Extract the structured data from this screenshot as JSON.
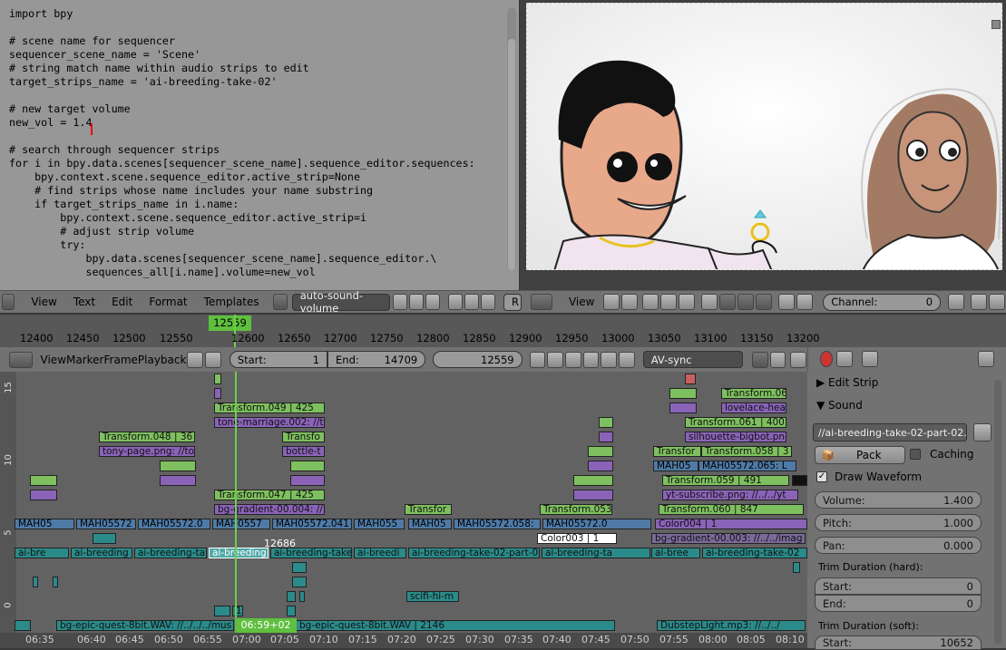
{
  "editor": {
    "code": "import bpy\n\n# scene name for sequencer\nsequencer_scene_name = 'Scene'\n# string match name within audio strips to edit\ntarget_strips_name = 'ai-breeding-take-02'\n\n# new target volume\nnew_vol = 1.4\n\n# search through sequencer strips\nfor i in bpy.data.scenes[sequencer_scene_name].sequence_editor.sequences:\n    bpy.context.scene.sequence_editor.active_strip=None\n    # find strips whose name includes your name substring\n    if target_strips_name in i.name:\n        bpy.context.scene.sequence_editor.active_strip=i\n        # adjust strip volume\n        try:\n            bpy.data.scenes[sequencer_scene_name].sequence_editor.\\\n            sequences_all[i.name].volume=new_vol",
    "menus": [
      "View",
      "Text",
      "Edit",
      "Format",
      "Templates"
    ],
    "text_name": "auto-sound-volume",
    "run_label": "R"
  },
  "preview": {
    "menu": "View",
    "channel_label": "Channel:",
    "channel_value": "0"
  },
  "timeline": {
    "current_frame_badge": "12559",
    "ruler_ticks": [
      "12400",
      "12450",
      "12500",
      "12550",
      "12600",
      "12650",
      "12700",
      "12750",
      "12800",
      "12850",
      "12900",
      "12950",
      "13000",
      "13050",
      "13100",
      "13150",
      "13200"
    ],
    "menus": [
      "View",
      "Marker",
      "Frame",
      "Playback"
    ],
    "start_label": "Start:",
    "start_value": "1",
    "end_label": "End:",
    "end_value": "14709",
    "current_frame": "12559",
    "sync_mode": "AV-sync"
  },
  "sequencer": {
    "channel_numbers": [
      "15",
      "10",
      "5",
      "0"
    ],
    "frame_marker": "12686",
    "time_badge": "06:59+02",
    "time_ticks": [
      "06:35",
      "06:40",
      "06:45",
      "06:50",
      "06:55",
      "07:00",
      "07:05",
      "07:10",
      "07:15",
      "07:20",
      "07:25",
      "07:30",
      "07:35",
      "07:40",
      "07:45",
      "07:50",
      "07:55",
      "08:00",
      "08:05",
      "08:10"
    ],
    "strips": {
      "transform049": "Transform.049 | 425",
      "tonemarriage": "tone-marriage.002: //t",
      "transform048": "Transform.048 | 36",
      "tonypage": "tony-page.png: //to",
      "transfo": "Transfo",
      "bottle": "bottle-t",
      "transform047": "Transform.047 | 425",
      "bggradient004": "bg-gradient-00.004: //",
      "transfor": "Transfor",
      "transform053": "Transform.053",
      "transform06": "Transform.06",
      "lovelace": "lovelace-hea",
      "transform061": "Transform.061 | 400",
      "silhouette": "silhouette-bigbot.png",
      "transfor2": "Transfor",
      "transform058": "Transform.058 | 3",
      "mah05a": "MAH05",
      "mah05572065": "MAH05572.065: L",
      "transform059": "Transform.059 | 491",
      "ytsub": "yt-subscribe.png: //../../yt",
      "transform060": "Transform.060 | 847",
      "audio1": "MAH05",
      "audio2": "MAH05572",
      "audio3": "MAH05572.0",
      "audio4": "MAH0557",
      "audio5": "MAH05572.041",
      "audio6": "MAH055",
      "audio7": "MAH05",
      "audio8": "MAH05572.058:",
      "audio9": "MAH05572.0",
      "color004": "Color004 | 1",
      "color003": "Color003 | 1",
      "bggradient003": "bg-gradient-00.003: //../../imag",
      "ai1": "ai-bre",
      "ai2": "ai-breeding",
      "ai3": "ai-breeding-ta",
      "ai4": "ai-breeding",
      "ai5": "ai-breeding-take",
      "ai6": "ai-breedi",
      "ai7": "ai-breeding-take-02-part-02",
      "ai8": "ai-breeding-ta",
      "ai9": "ai-bree",
      "ai10": "ai-breeding-take-02",
      "scifi": "scifi-hi-m",
      "music1": "bg-epic-quest-8bit.WAV: //../../../mus",
      "music2": "bg-epic-quest-8bit.WAV | 2146",
      "music3": "DubstepLight.mp3: //../../",
      "small18": "18"
    }
  },
  "properties": {
    "edit_strip": "Edit Strip",
    "sound": "Sound",
    "file_path": "//ai-breeding-take-02-part-02....",
    "pack_label": "Pack",
    "caching_label": "Caching",
    "draw_waveform_label": "Draw Waveform",
    "volume_label": "Volume:",
    "volume_value": "1.400",
    "pitch_label": "Pitch:",
    "pitch_value": "1.000",
    "pan_label": "Pan:",
    "pan_value": "0.000",
    "trim_hard": "Trim Duration (hard):",
    "hard_start_label": "Start:",
    "hard_start_value": "0",
    "hard_end_label": "End:",
    "hard_end_value": "0",
    "trim_soft": "Trim Duration (soft):",
    "soft_start_label": "Start:",
    "soft_start_value": "10652"
  },
  "colors": {
    "image_strip": "#7ec05f",
    "meta_strip": "#8a63b8",
    "movie_strip": "#4f7aa6",
    "sound_strip": "#2b8a8a",
    "playhead": "#6bcf47"
  }
}
